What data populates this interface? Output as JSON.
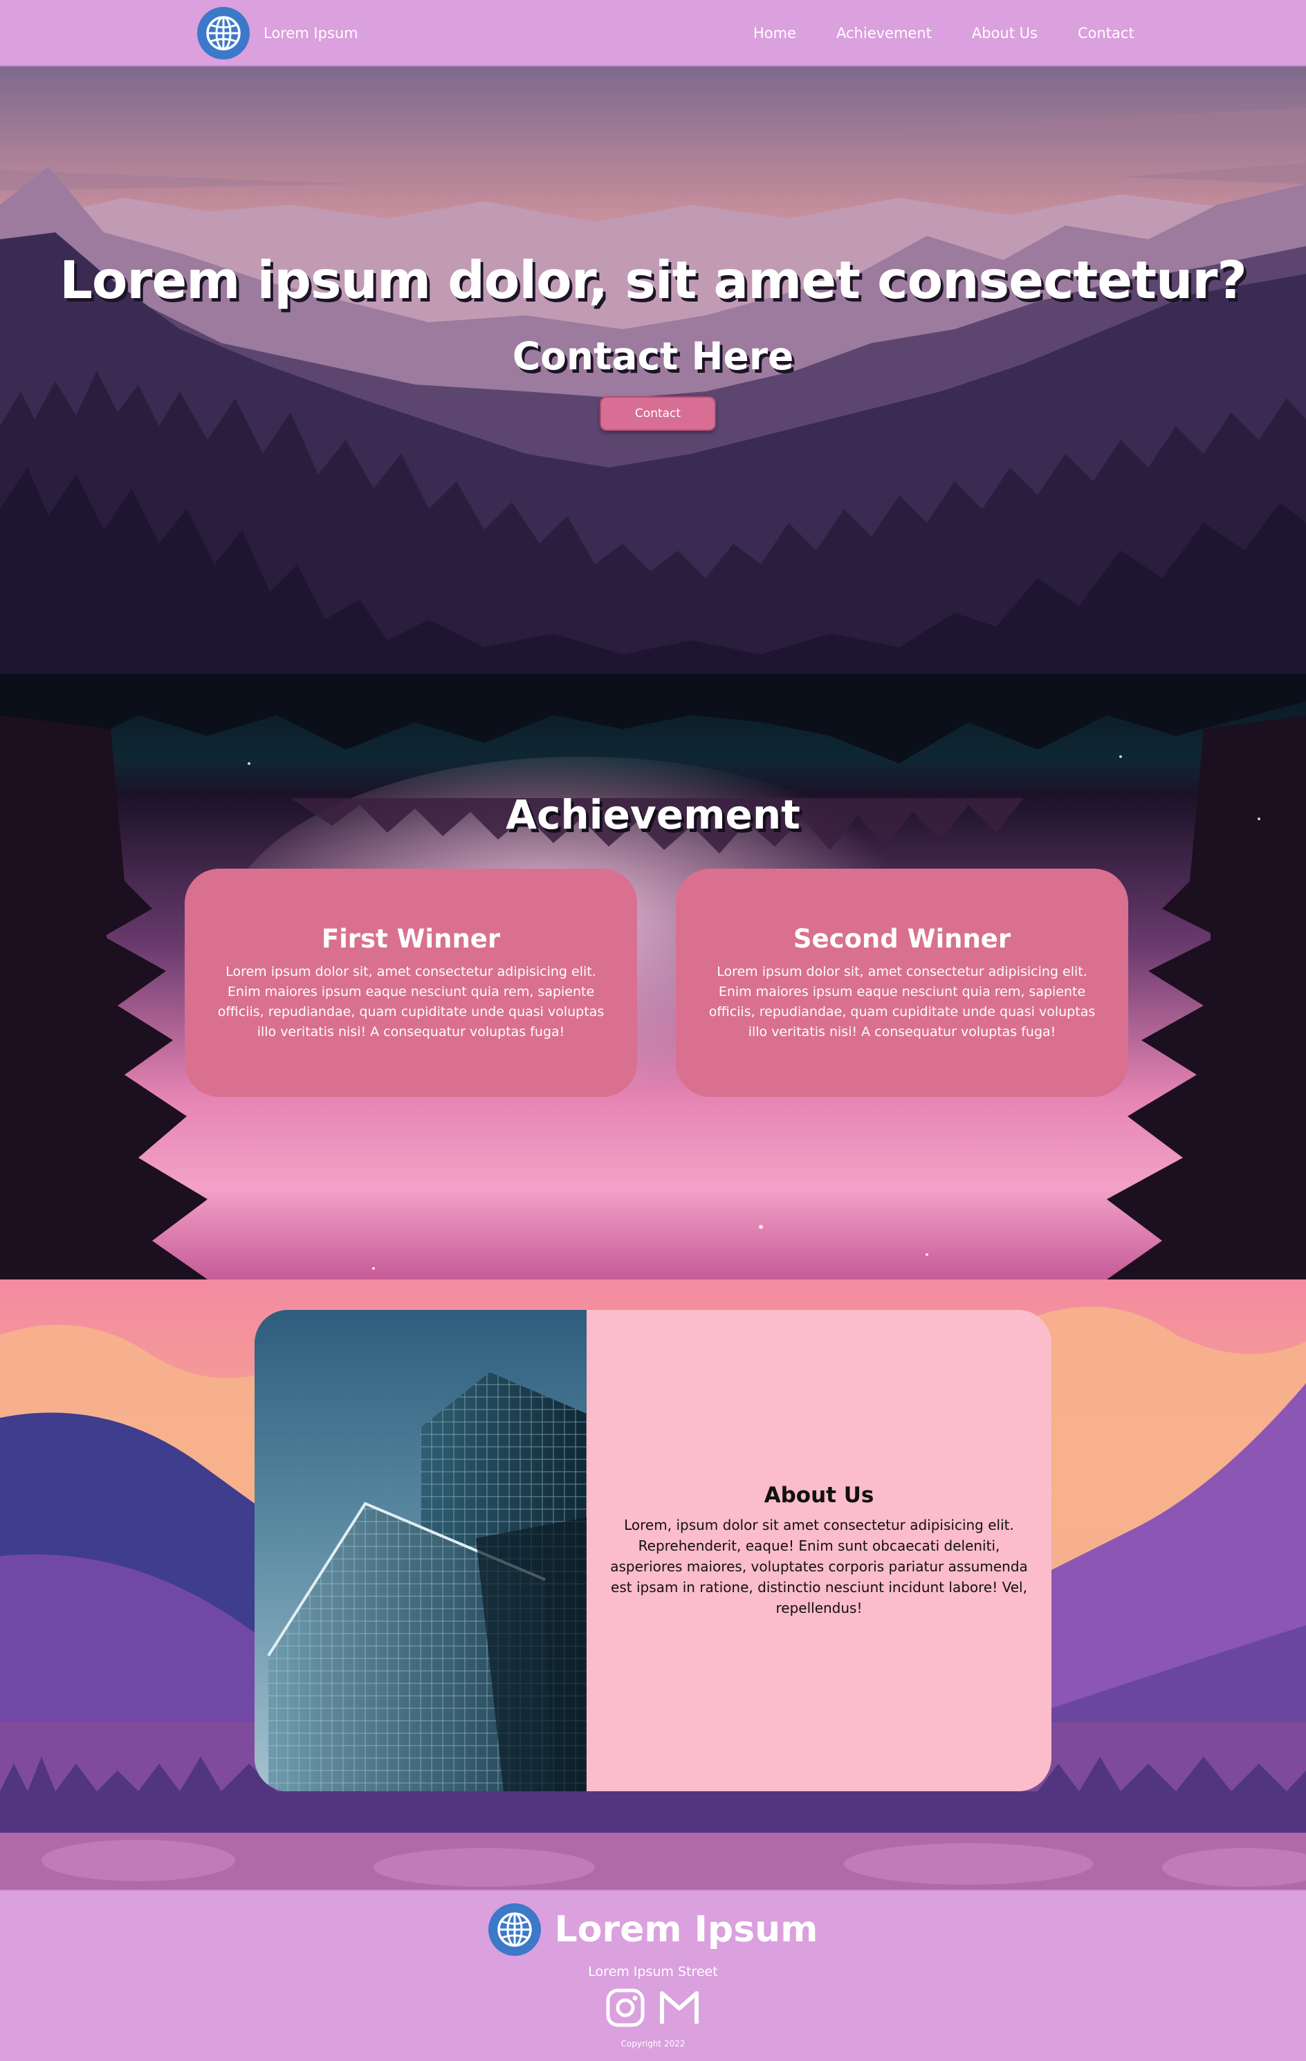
{
  "navbar": {
    "brand": "Lorem Ipsum",
    "logo_icon": "globe-icon",
    "links": [
      "Home",
      "Achievement",
      "About Us",
      "Contact"
    ]
  },
  "hero": {
    "title": "Lorem ipsum dolor, sit amet consectetur?",
    "subtitle": "Contact Here",
    "button": "Contact"
  },
  "achievement": {
    "title": "Achievement",
    "cards": [
      {
        "title": "First Winner",
        "text": "Lorem ipsum dolor sit, amet consectetur adipisicing elit. Enim maiores ipsum eaque nesciunt quia rem, sapiente officiis, repudiandae, quam cupiditate unde quasi voluptas illo veritatis nisi! A consequatur voluptas fuga!"
      },
      {
        "title": "Second Winner",
        "text": "Lorem ipsum dolor sit, amet consectetur adipisicing elit. Enim maiores ipsum eaque nesciunt quia rem, sapiente officiis, repudiandae, quam cupiditate unde quasi voluptas illo veritatis nisi! A consequatur voluptas fuga!"
      }
    ]
  },
  "about": {
    "title": "About Us",
    "text": "Lorem, ipsum dolor sit amet consectetur adipisicing elit. Reprehenderit, eaque! Enim sunt obcaecati deleniti, asperiores maiores, voluptates corporis pariatur assumenda est ipsam in ratione, distinctio nesciunt incidunt labore! Vel, repellendus!"
  },
  "footer": {
    "brand": "Lorem Ipsum",
    "street": "Lorem Ipsum Street",
    "icons": [
      "instagram-icon",
      "gmail-icon"
    ],
    "copyright": "Copyright 2022"
  },
  "colors": {
    "nav_bg": "#dba0de",
    "accent_pink": "#d86e93",
    "card_pink": "#d9708f",
    "about_card": "#fbbccb",
    "logo_blue": "#3c79c8"
  }
}
